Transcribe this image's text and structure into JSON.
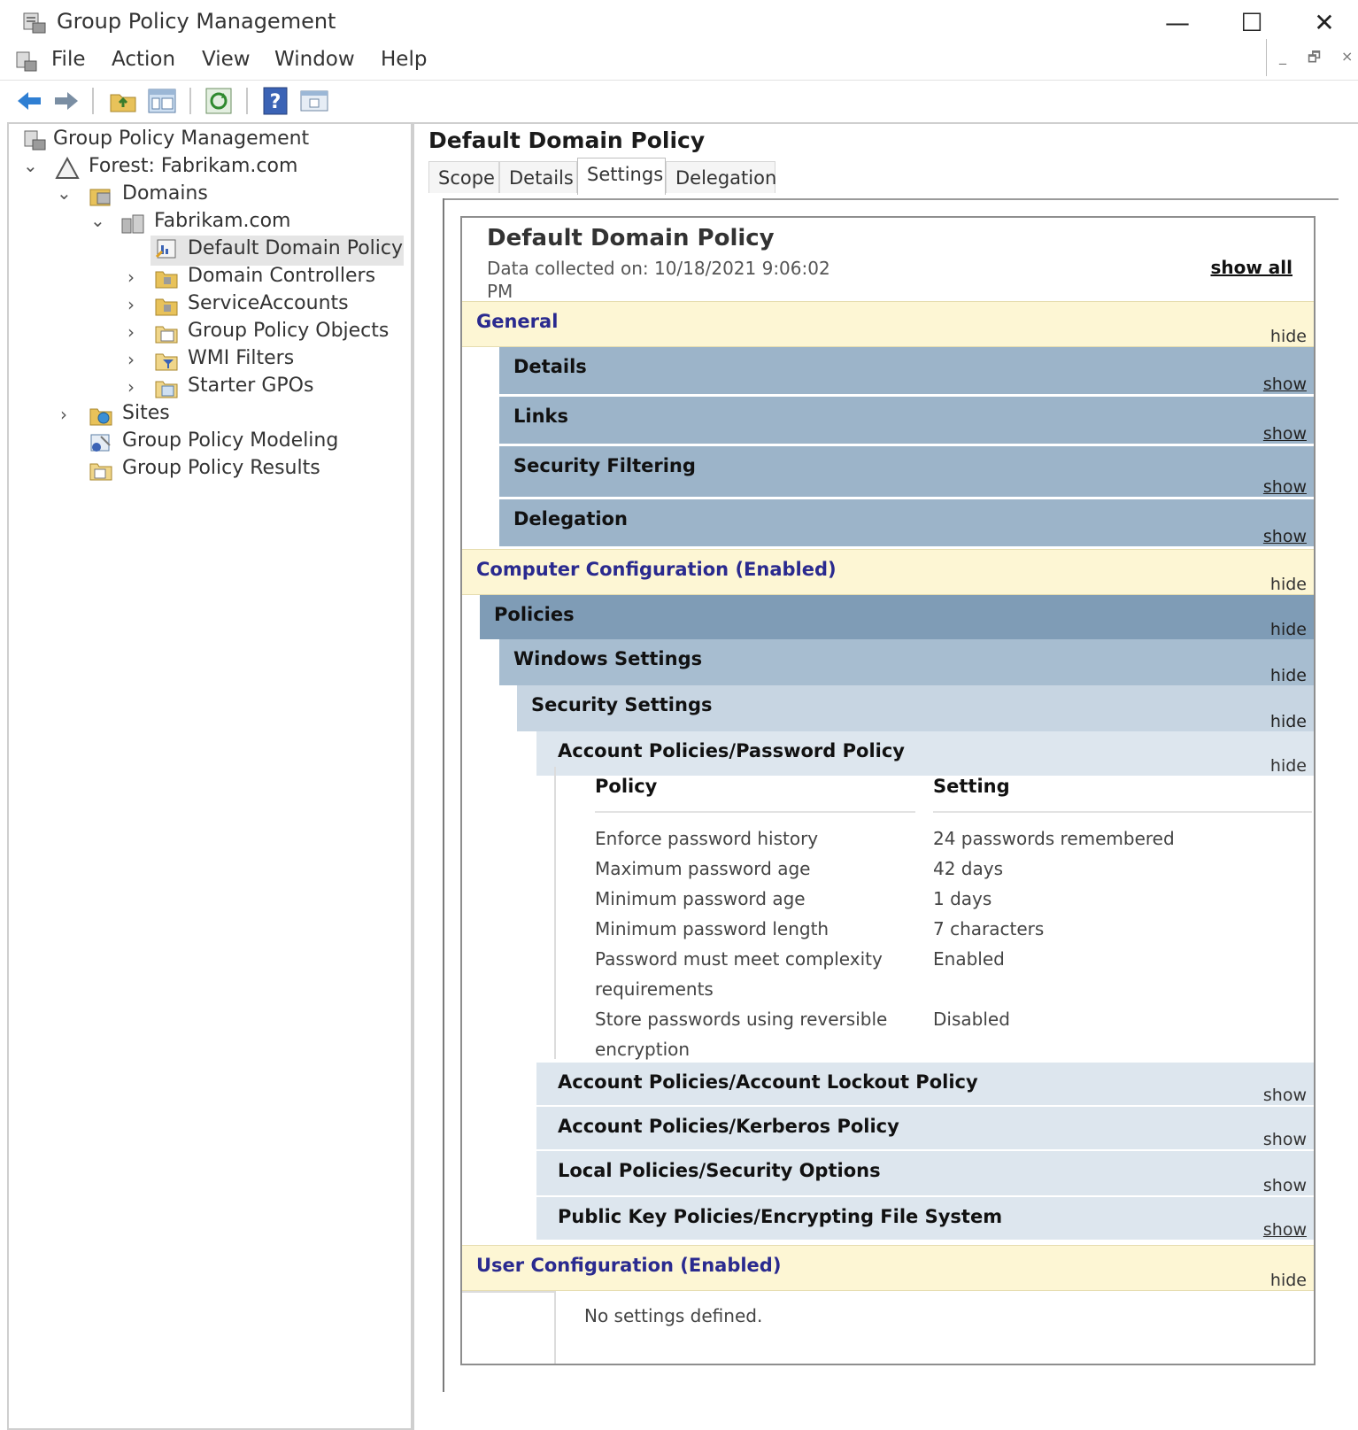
{
  "window": {
    "title": "Group Policy Management",
    "minimize": "—",
    "maximize": "☐",
    "close": "✕"
  },
  "menu": [
    "File",
    "Action",
    "View",
    "Window",
    "Help"
  ],
  "mdi": {
    "min": "_",
    "restore": "🗗",
    "close": "×"
  },
  "tree": [
    {
      "label": "Group Policy Management",
      "chevron": ""
    },
    {
      "label": "Forest: Fabrikam.com",
      "chevron": "⌄"
    },
    {
      "label": "Domains",
      "chevron": "⌄"
    },
    {
      "label": "Fabrikam.com",
      "chevron": "⌄"
    },
    {
      "label": "Default Domain Policy",
      "chevron": ""
    },
    {
      "label": "Domain Controllers",
      "chevron": "›"
    },
    {
      "label": "ServiceAccounts",
      "chevron": "›"
    },
    {
      "label": "Group Policy Objects",
      "chevron": "›"
    },
    {
      "label": "WMI Filters",
      "chevron": "›"
    },
    {
      "label": "Starter GPOs",
      "chevron": "›"
    },
    {
      "label": "Sites",
      "chevron": "›"
    },
    {
      "label": "Group Policy Modeling",
      "chevron": ""
    },
    {
      "label": "Group Policy Results",
      "chevron": ""
    }
  ],
  "main": {
    "title": "Default Domain Policy",
    "tabs": [
      "Scope",
      "Details",
      "Settings",
      "Delegation"
    ],
    "active_tab": "Settings"
  },
  "report": {
    "title": "Default Domain Policy",
    "collected": "Data collected on: 10/18/2021 9:06:02 PM",
    "show_all": "show all",
    "sections": {
      "general": {
        "label": "General",
        "toggle": "hide"
      },
      "details": {
        "label": "Details",
        "toggle": "show"
      },
      "links": {
        "label": "Links",
        "toggle": "show"
      },
      "security_filtering": {
        "label": "Security Filtering",
        "toggle": "show"
      },
      "delegation": {
        "label": "Delegation",
        "toggle": "show"
      },
      "computer_config": {
        "label": "Computer Configuration (Enabled)",
        "toggle": "hide"
      },
      "policies": {
        "label": "Policies",
        "toggle": "hide"
      },
      "windows_settings": {
        "label": "Windows Settings",
        "toggle": "hide"
      },
      "security_settings": {
        "label": "Security Settings",
        "toggle": "hide"
      },
      "password_policy": {
        "label": "Account Policies/Password Policy",
        "toggle": "hide"
      },
      "lockout_policy": {
        "label": "Account Policies/Account Lockout Policy",
        "toggle": "show"
      },
      "kerberos_policy": {
        "label": "Account Policies/Kerberos Policy",
        "toggle": "show"
      },
      "security_options": {
        "label": "Local Policies/Security Options",
        "toggle": "show"
      },
      "efs": {
        "label": "Public Key Policies/Encrypting File System",
        "toggle": "show"
      },
      "user_config": {
        "label": "User Configuration (Enabled)",
        "toggle": "hide"
      }
    },
    "policy_table": {
      "headers": [
        "Policy",
        "Setting"
      ],
      "rows": [
        {
          "policy": "Enforce password history",
          "setting": "24 passwords remembered"
        },
        {
          "policy": "Maximum password age",
          "setting": "42 days"
        },
        {
          "policy": "Minimum password age",
          "setting": "1 days"
        },
        {
          "policy": "Minimum password length",
          "setting": "7 characters"
        },
        {
          "policy": "Password must meet complexity requirements",
          "setting": "Enabled"
        },
        {
          "policy": "Store passwords using reversible encryption",
          "setting": "Disabled"
        }
      ]
    },
    "no_settings": "No settings defined."
  },
  "icons": {
    "app": "gpm-console-icon",
    "back": "back-arrow-icon",
    "forward": "forward-arrow-icon",
    "up": "up-folder-icon",
    "show_hide_tree": "console-tree-icon",
    "refresh": "refresh-icon",
    "help": "help-icon",
    "properties": "properties-icon"
  },
  "colors": {
    "section_yellow": "#fdf6d4",
    "section_blue": "#9cb4c9",
    "link_blue": "#2a2a8f"
  }
}
